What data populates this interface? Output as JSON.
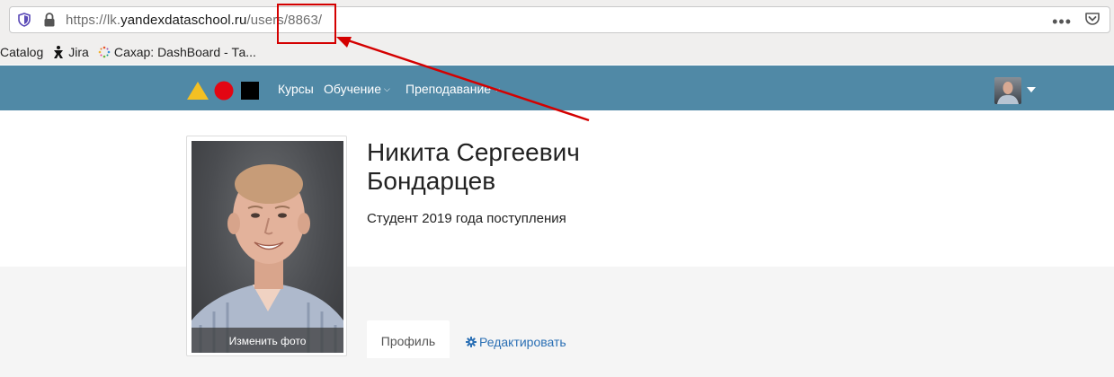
{
  "browser": {
    "url_prefix": "https://lk.",
    "url_domain": "yandexdataschool.ru",
    "url_path": "/users/8863/",
    "bookmarks": [
      {
        "label": "Catalog"
      },
      {
        "label": "Jira"
      },
      {
        "label": "Сахар: DashBoard - Та..."
      }
    ]
  },
  "nav": {
    "items": [
      {
        "label": "Курсы"
      },
      {
        "label": "Обучение"
      },
      {
        "label": "Преподавание"
      }
    ],
    "bg_color": "#5089a6"
  },
  "profile": {
    "name": "Никита Сергеевич Бондарцев",
    "subtitle": "Студент 2019 года поступления",
    "photo_caption": "Изменить фото"
  },
  "tabs": {
    "active": "Профиль",
    "edit": "Редактировать"
  },
  "colors": {
    "link": "#2a6fb4",
    "annotation": "#d40000"
  }
}
